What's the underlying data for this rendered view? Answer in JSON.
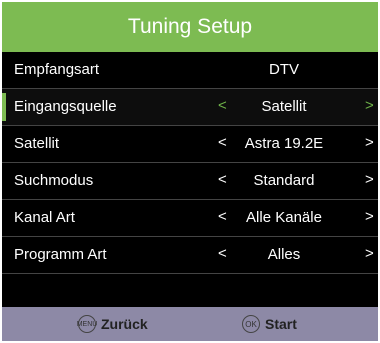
{
  "header": {
    "title": "Tuning Setup"
  },
  "rows": [
    {
      "label": "Empfangsart",
      "value": "DTV",
      "left": "",
      "right": ""
    },
    {
      "label": "Eingangsquelle",
      "value": "Satellit",
      "left": "<",
      "right": ">"
    },
    {
      "label": "Satellit",
      "value": "Astra 19.2E",
      "left": "<",
      "right": ">"
    },
    {
      "label": "Suchmodus",
      "value": "Standard",
      "left": "<",
      "right": ">"
    },
    {
      "label": "Kanal Art",
      "value": "Alle Kanäle",
      "left": "<",
      "right": ">"
    },
    {
      "label": "Programm Art",
      "value": "Alles",
      "left": "<",
      "right": ">"
    }
  ],
  "footer": {
    "back_icon": "MENU",
    "back_label": "Zurück",
    "start_icon": "OK",
    "start_label": "Start"
  },
  "colors": {
    "accent": "#7dbb52",
    "footer_bg": "#8d89a6",
    "background": "#000000"
  }
}
